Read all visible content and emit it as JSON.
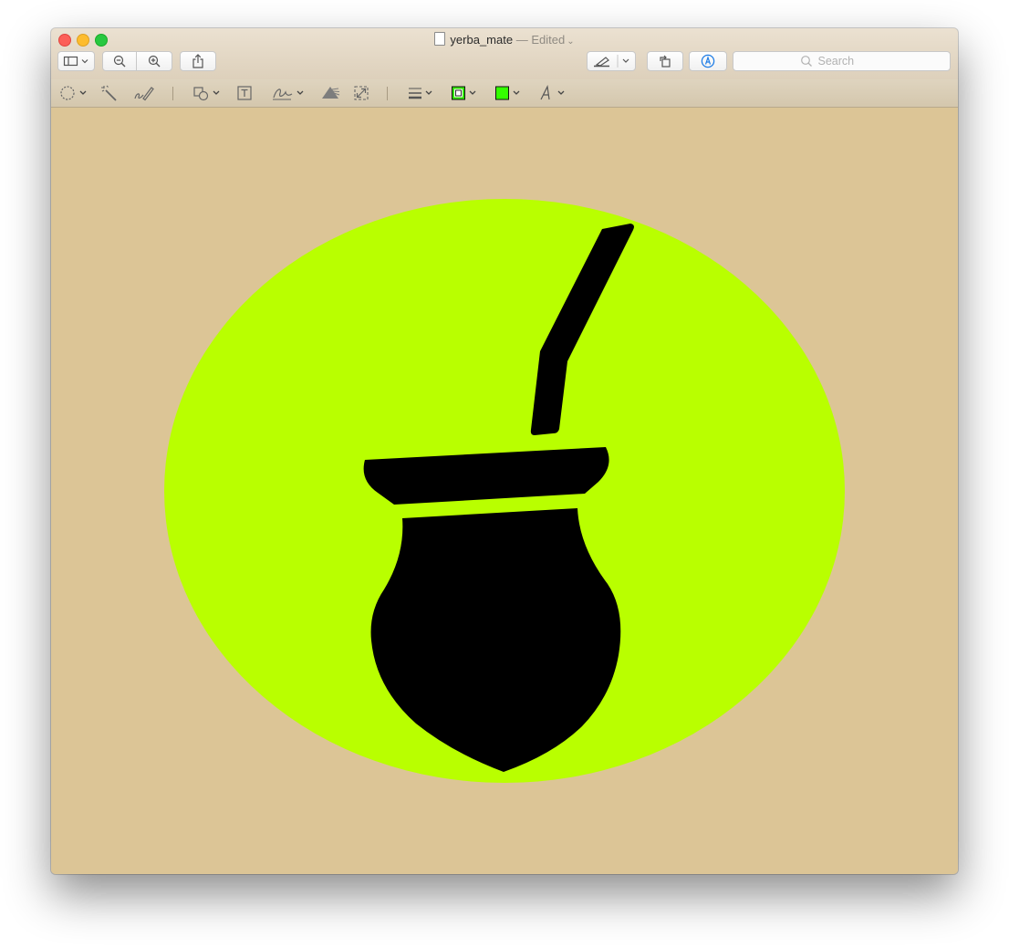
{
  "window": {
    "filename": "yerba_mate",
    "status": "— Edited"
  },
  "toolbar": {
    "search_placeholder": "Search",
    "sidebar_icon": "sidebar-icon",
    "zoom_out_icon": "zoom-out-icon",
    "zoom_in_icon": "zoom-in-icon",
    "share_icon": "share-icon",
    "highlight_icon": "highlighter-icon",
    "rotate_icon": "rotate-left-icon",
    "markup_icon": "markup-pen-icon"
  },
  "markup_toolbar": {
    "tools": [
      "rect-selection-icon",
      "instant-alpha-icon",
      "sketch-icon",
      "shapes-icon",
      "text-box-icon",
      "signature-icon",
      "adjust-color-icon",
      "adjust-size-icon",
      "shape-style-icon",
      "border-color-icon",
      "fill-color-icon",
      "text-style-icon"
    ],
    "border_color": "#2fe600",
    "fill_color": "#33ff00"
  },
  "canvas": {
    "background_color": "#dcc596",
    "circle_color": "#b9ff00",
    "object_color": "#000000"
  }
}
